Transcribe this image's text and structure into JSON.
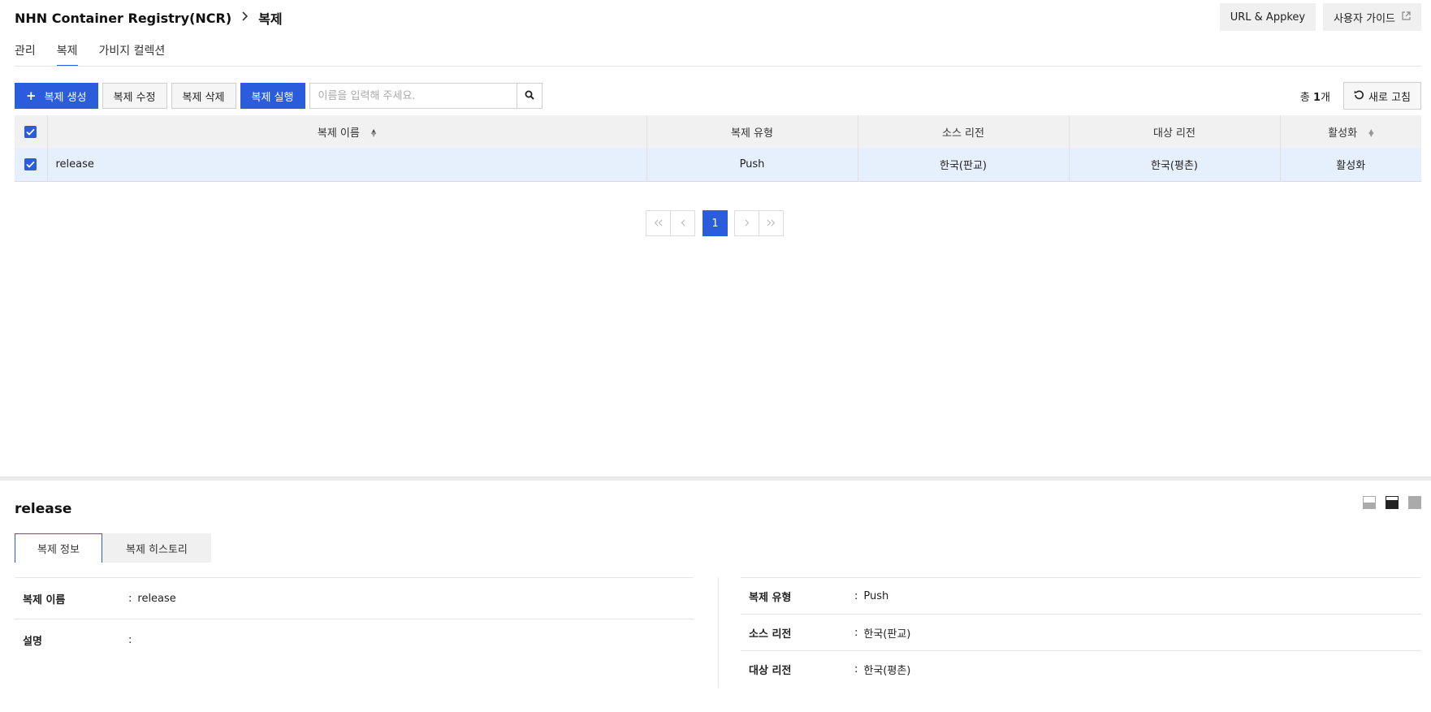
{
  "header": {
    "breadcrumb_root": "NHN Container Registry(NCR)",
    "breadcrumb_current": "복제",
    "url_appkey_label": "URL & Appkey",
    "user_guide_label": "사용자 가이드"
  },
  "tabs": [
    {
      "label": "관리",
      "active": false
    },
    {
      "label": "복제",
      "active": true
    },
    {
      "label": "가비지 컬렉션",
      "active": false
    }
  ],
  "toolbar": {
    "create_label": "복제 생성",
    "edit_label": "복제 수정",
    "delete_label": "복제 삭제",
    "run_label": "복제 실행",
    "search_placeholder": "이름을 입력해 주세요."
  },
  "summary": {
    "total_prefix": "총 ",
    "total_count": "1",
    "total_suffix": "개",
    "refresh_label": "새로 고침"
  },
  "table": {
    "columns": [
      "복제 이름",
      "복제 유형",
      "소스 리전",
      "대상 리전",
      "활성화"
    ],
    "rows": [
      {
        "name": "release",
        "type": "Push",
        "source_region": "한국(판교)",
        "target_region": "한국(평촌)",
        "enabled": "활성화",
        "checked": true
      }
    ]
  },
  "pagination": {
    "current": "1"
  },
  "detail": {
    "title": "release",
    "tabs": [
      {
        "label": "복제 정보",
        "active": true
      },
      {
        "label": "복제 히스토리",
        "active": false
      }
    ],
    "left": [
      {
        "label": "복제 이름",
        "value": "release"
      },
      {
        "label": "설명",
        "value": ""
      }
    ],
    "right": [
      {
        "label": "복제 유형",
        "value": "Push"
      },
      {
        "label": "소스 리전",
        "value": "한국(판교)"
      },
      {
        "label": "대상 리전",
        "value": "한국(평촌)"
      }
    ]
  },
  "colors": {
    "accent": "#2a5cdc",
    "selected_row": "#e6effc",
    "header_bg": "#f1f1f1"
  }
}
